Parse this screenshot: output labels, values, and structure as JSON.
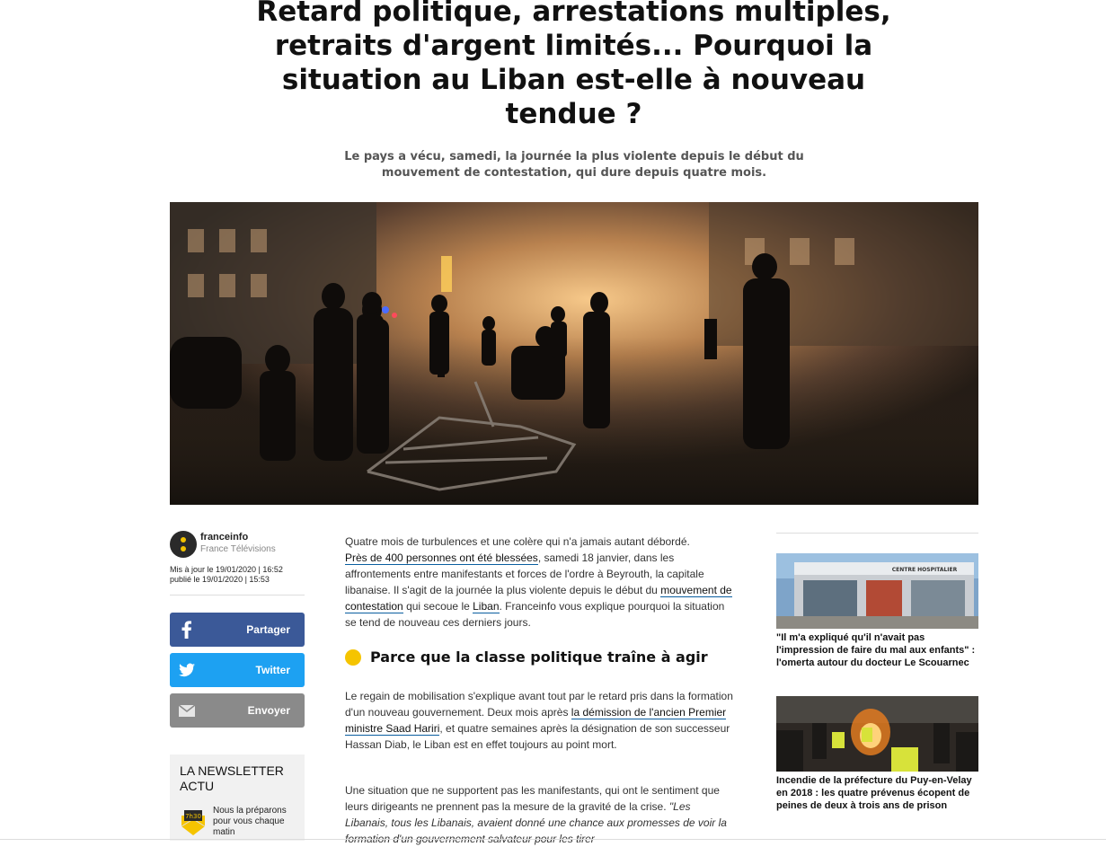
{
  "article": {
    "title": "Retard politique, arrestations multiples, retraits d'argent limités... Pourquoi la situation au Liban est-elle à nouveau tendue ?",
    "subtitle": "Le pays a vécu, samedi, la journée la plus violente depuis le début du mouvement de contestation, qui dure depuis quatre mois.",
    "hero_alt": "Affrontements nocturnes dans une rue de Beyrouth, silhouettes dans la fumée et les gaz"
  },
  "author": {
    "name": "franceinfo",
    "org": "France Télévisions",
    "updated": "Mis à jour le 19/01/2020 | 16:52",
    "published": "publié le 19/01/2020 | 15:53"
  },
  "share": {
    "facebook": "Partager",
    "twitter": "Twitter",
    "email": "Envoyer"
  },
  "newsletter": {
    "title": "LA NEWSLETTER ACTU",
    "icon_label": "7h30",
    "text": "Nous la préparons pour vous chaque matin"
  },
  "body": {
    "p1": {
      "t1": "Quatre mois de turbulences et une colère qui n'a jamais autant débordé.",
      "link1": "Près de 400 personnes ont été blessées",
      "t2": ", samedi 18 janvier, dans les affrontements entre manifestants et forces de l'ordre à Beyrouth, la capitale libanaise. Il s'agit de la journée la plus violente depuis le début du",
      "link2": "mouvement de contestation",
      "t3": "qui secoue le",
      "link3": "Liban",
      "t4": ". Franceinfo vous explique pourquoi la situation se tend de nouveau ces derniers jours."
    },
    "heading1": "Parce que la classe politique traîne à agir",
    "p2": {
      "t1": "Le regain de mobilisation s'explique avant tout par le retard pris dans la formation d'un nouveau gouvernement. Deux mois après",
      "link1": "la démission de l'ancien Premier ministre Saad Hariri",
      "t2": ", et quatre semaines après la désignation de son successeur Hassan Diab, le Liban est en effet toujours au point mort."
    },
    "p3": {
      "t1": "Une situation que ne supportent pas les manifestants, qui ont le sentiment que leurs dirigeants ne prennent pas la mesure de la gravité de la crise.",
      "quote": "\"Les Libanais, tous les Libanais, avaient donné une chance aux promesses de voir la formation d'un gouvernement salvateur pour les tirer"
    }
  },
  "related": [
    {
      "title": "\"Il m'a expliqué qu'il n'avait pas l'impression de faire du mal aux enfants\" : l'omerta autour du docteur Le Scouarnec",
      "image_alt": "Façade d'un bâtiment hospitalier",
      "sign_text": "CENTRE HOSPITALIER"
    },
    {
      "title": "Incendie de la préfecture du Puy-en-Velay en 2018 : les quatre prévenus écopent de peines de deux à trois ans de prison",
      "image_alt": "Manifestants en gilets jaunes devant un incendie"
    }
  ],
  "colors": {
    "facebook": "#3b5998",
    "twitter": "#1da1f2",
    "email": "#8a8a8a",
    "accent_yellow": "#f5c400",
    "link_underline": "#0a5ea0"
  }
}
